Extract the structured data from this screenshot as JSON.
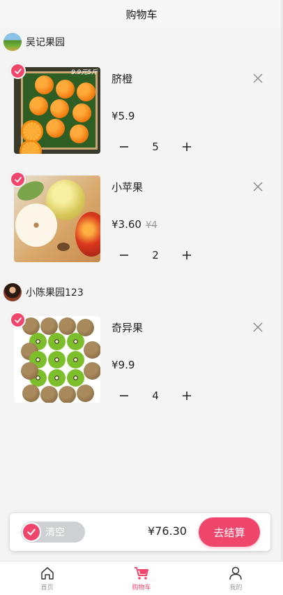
{
  "header": {
    "title": "购物车"
  },
  "shops": [
    {
      "name": "吴记果园",
      "items": [
        {
          "name": "脐橙",
          "price": "¥5.9",
          "old_price": "",
          "qty": "5",
          "checked": true
        },
        {
          "name": "小苹果",
          "price": "¥3.60",
          "old_price": "¥4",
          "qty": "2",
          "checked": true
        }
      ]
    },
    {
      "name": "小陈果园123",
      "items": [
        {
          "name": "奇异果",
          "price": "¥9.9",
          "old_price": "",
          "qty": "4",
          "checked": true
        }
      ]
    }
  ],
  "product_image_text": {
    "orange_tag": "9.9元5斤"
  },
  "checkout": {
    "clear_label": "清空",
    "total": "¥76.30",
    "pay_label": "去结算"
  },
  "tabbar": {
    "tabs": [
      {
        "label": "首页"
      },
      {
        "label": "购物车"
      },
      {
        "label": "我的"
      }
    ],
    "active_index": 1
  },
  "colors": {
    "accent": "#f0466b",
    "background": "#f4f4f4",
    "muted": "#999999"
  },
  "icons": {
    "check": "check-icon",
    "close": "close-icon",
    "minus": "minus-icon",
    "plus": "plus-icon",
    "home": "home-icon",
    "cart": "cart-icon",
    "user": "user-icon"
  }
}
